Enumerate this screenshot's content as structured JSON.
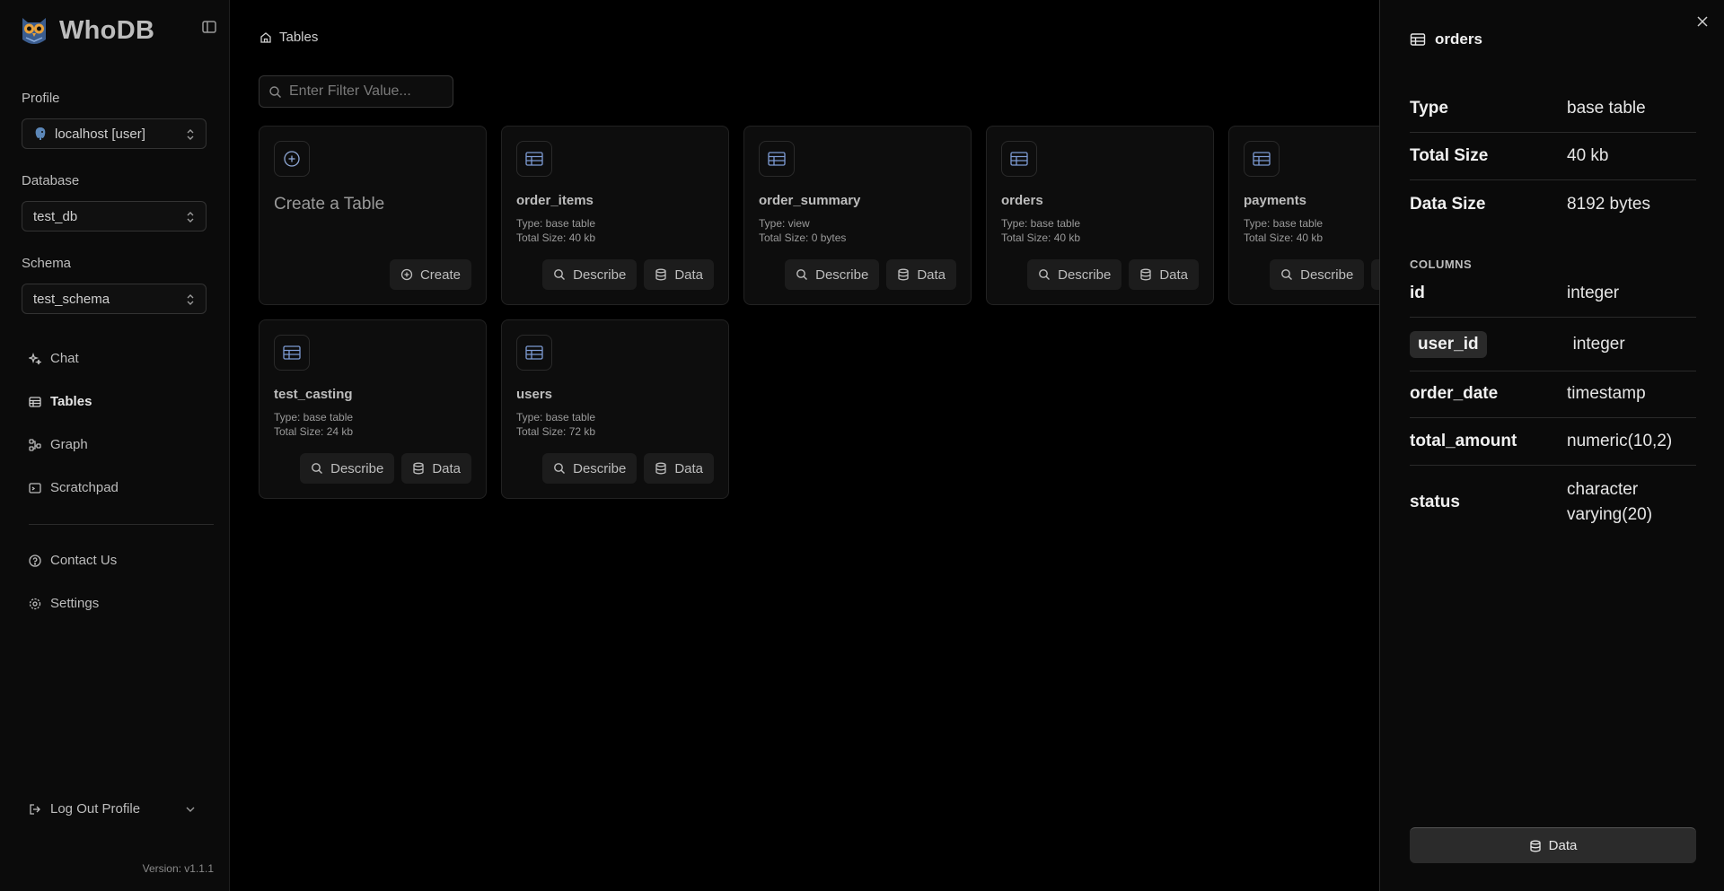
{
  "app": {
    "name": "WhoDB",
    "version": "Version: v1.1.1"
  },
  "sidebar": {
    "profile_label": "Profile",
    "profile_value": "localhost [user]",
    "database_label": "Database",
    "database_value": "test_db",
    "schema_label": "Schema",
    "schema_value": "test_schema",
    "nav": [
      {
        "label": "Chat",
        "icon": "sparkles-icon"
      },
      {
        "label": "Tables",
        "icon": "table-icon",
        "active": true
      },
      {
        "label": "Graph",
        "icon": "graph-icon"
      },
      {
        "label": "Scratchpad",
        "icon": "terminal-icon"
      }
    ],
    "secondary": [
      {
        "label": "Contact Us",
        "icon": "help-circle-icon"
      },
      {
        "label": "Settings",
        "icon": "gear-icon"
      }
    ],
    "logout_label": "Log Out Profile"
  },
  "main": {
    "breadcrumb": "Tables",
    "filter_placeholder": "Enter Filter Value...",
    "create_card": {
      "title": "Create a Table",
      "button": "Create"
    },
    "buttons": {
      "describe": "Describe",
      "data": "Data"
    },
    "tables": [
      {
        "name": "order_items",
        "type": "Type: base table",
        "size": "Total Size: 40 kb"
      },
      {
        "name": "order_summary",
        "type": "Type: view",
        "size": "Total Size: 0 bytes"
      },
      {
        "name": "orders",
        "type": "Type: base table",
        "size": "Total Size: 40 kb"
      },
      {
        "name": "payments",
        "type": "Type: base table",
        "size": "Total Size: 40 kb"
      },
      {
        "name": "test_casting",
        "type": "Type: base table",
        "size": "Total Size: 24 kb"
      },
      {
        "name": "users",
        "type": "Type: base table",
        "size": "Total Size: 72 kb"
      }
    ]
  },
  "drawer": {
    "title": "orders",
    "details": [
      {
        "key": "Type",
        "value": "base table"
      },
      {
        "key": "Total Size",
        "value": "40 kb"
      },
      {
        "key": "Data Size",
        "value": "8192 bytes"
      }
    ],
    "columns_label": "COLUMNS",
    "columns": [
      {
        "name": "id",
        "type": "integer"
      },
      {
        "name": "user_id",
        "type": "integer"
      },
      {
        "name": "order_date",
        "type": "timestamp"
      },
      {
        "name": "total_amount",
        "type": "numeric(10,2)"
      },
      {
        "name": "status",
        "type_line1": "character",
        "type_line2": "varying(20)"
      }
    ],
    "data_button": "Data"
  },
  "colors": {
    "background": "#000000",
    "sidebar": "#0b0b0b",
    "card": "#0d0d0d",
    "icon_accent": "#6f8fc9",
    "button": "#1c1c1c"
  }
}
